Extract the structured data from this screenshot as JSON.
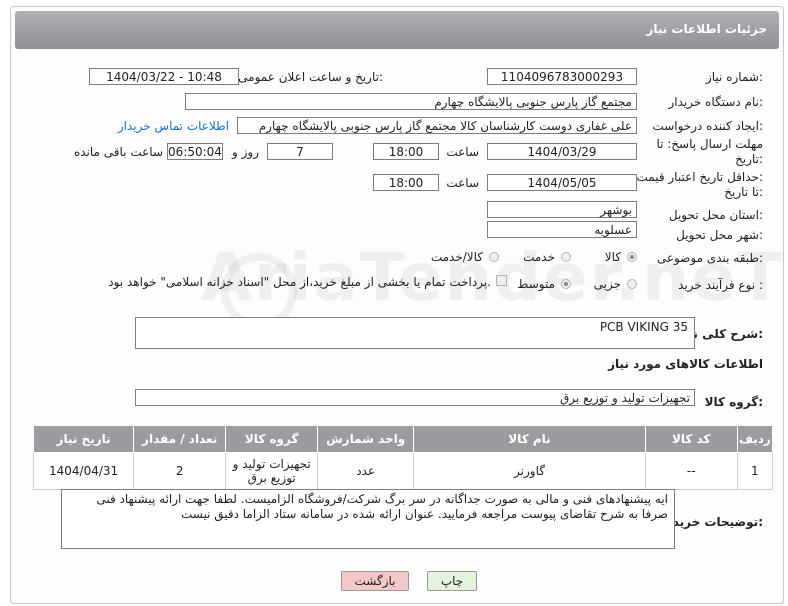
{
  "header": {
    "title": "جزئیات اطلاعات نیاز"
  },
  "labels": {
    "need_number": "شماره نیاز:",
    "announce_datetime": "تاریخ و ساعت اعلان عمومی:",
    "buyer_org": "نام دستگاه خریدار:",
    "requester": "ایجاد کننده درخواست:",
    "deadline_line1": "مهلت ارسال پاسخ: تا",
    "deadline_line2": "تاریخ:",
    "time": "ساعت",
    "day_and": "روز و",
    "time_remaining": "ساعت باقی مانده",
    "validity_line1": "حداقل تاریخ اعتبار قیمت:",
    "validity_line2": "تا تاریخ:",
    "province": "استان محل تحویل:",
    "city": "شهر محل تحویل:",
    "category": "طبقه بندی موضوعی:",
    "purchase_type": "نوع فرآیند خرید :",
    "general_desc": "شرح کلی نیاز:",
    "goods_info": "اطلاعات کالاهای مورد نیاز",
    "goods_group": "گروه کالا:",
    "buyer_notes": "توضیحات خریدار:"
  },
  "values": {
    "need_number": "1104096783000293",
    "announce_datetime": "1404/03/22 - 10:48",
    "buyer_org": "مجتمع گاز پارس جنوبی  پالایشگاه چهارم",
    "requester": "علی غفاری دوست کارشناسان کالا مجتمع گاز پارس جنوبی  پالایشگاه چهارم",
    "contact_link": "اطلاعات تماس خریدار",
    "deadline_date": "1404/03/29",
    "deadline_time": "18:00",
    "days_remaining": "7",
    "hours_remaining": "06:50:04",
    "validity_date": "1404/05/05",
    "validity_time": "18:00",
    "province": "بوشهر",
    "city": "عسلویه",
    "general_desc": "PCB  VIKING 35",
    "goods_group": "تجهیزات تولید و توزیع برق",
    "buyer_notes": "ایه پیشنهادهای فنی و مالی به صورت جداگانه در سر برگ شرکت/فروشگاه الزامیست. لطفا جهت ارائه پیشنهاد فنی صرفا به شرح تقاضای پیوست مراجعه فرمایید. عنوان ارائه شده در سامانه ستاد الزاما دقیق نیست"
  },
  "category_options": [
    "کالا",
    "خدمت",
    "کالا/خدمت"
  ],
  "category_selected": "کالا",
  "purchase_options": [
    "جزیی",
    "متوسط"
  ],
  "purchase_note": "پرداخت تمام یا بخشی از مبلغ خرید،از محل \"اسناد خزانه اسلامی\" خواهد بود.",
  "table": {
    "headers": [
      "ردیف",
      "کد کالا",
      "نام کالا",
      "واحد شمارش",
      "گروه کالا",
      "تعداد / مقدار",
      "تاریخ نیاز"
    ],
    "rows": [
      [
        "1",
        "--",
        "گاورنر",
        "عدد",
        "تجهیزات تولید و توزیع برق",
        "2",
        "1404/04/31"
      ]
    ]
  },
  "buttons": {
    "print": "چاپ",
    "back": "بازگشت"
  },
  "watermark": "AriaTender.neT",
  "colors": {
    "header_bg": "#8f9196",
    "link": "#1a6fd0",
    "back_btn": "#f4c8c8",
    "print_btn": "#e4f2de"
  }
}
